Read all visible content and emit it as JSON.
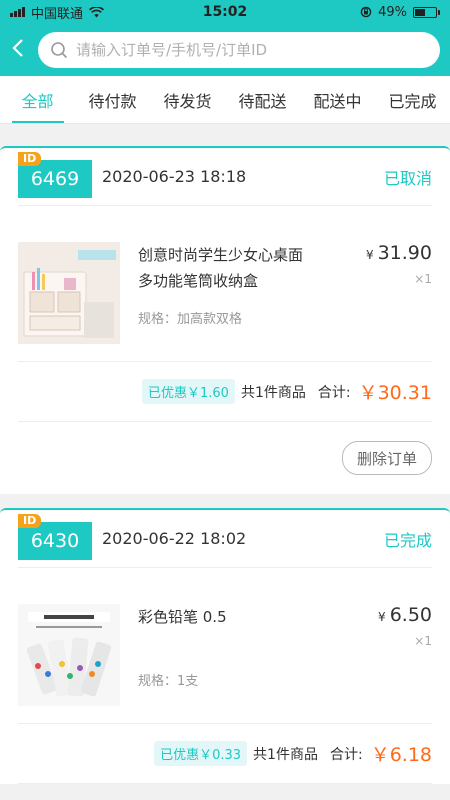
{
  "statusbar": {
    "carrier": "中国联通",
    "time": "15:02",
    "battery": "49%"
  },
  "search": {
    "placeholder": "请输入订单号/手机号/订单ID"
  },
  "tabs": [
    {
      "label": "全部",
      "active": true
    },
    {
      "label": "待付款"
    },
    {
      "label": "待发货"
    },
    {
      "label": "待配送"
    },
    {
      "label": "配送中"
    },
    {
      "label": "已完成"
    }
  ],
  "orders": [
    {
      "id_tag": "ID",
      "id": "6469",
      "date": "2020-06-23 18:18",
      "status": "已取消",
      "item": {
        "name_line1": "创意时尚学生少女心桌面",
        "name_line2": "多功能笔筒收纳盒",
        "spec": "规格：加高款双格",
        "currency": "¥",
        "price": "31.90",
        "qty": "×1"
      },
      "discount": "已优惠￥1.60",
      "count": "共1件商品",
      "total_label": "合计:",
      "total": "￥30.31",
      "action": "删除订单"
    },
    {
      "id_tag": "ID",
      "id": "6430",
      "date": "2020-06-22 18:02",
      "status": "已完成",
      "item": {
        "name_line1": "彩色铅笔 0.5",
        "name_line2": "",
        "spec": "规格：1支",
        "currency": "¥",
        "price": "6.50",
        "qty": "×1"
      },
      "discount": "已优惠￥0.33",
      "count": "共1件商品",
      "total_label": "合计:",
      "total": "￥6.18"
    }
  ],
  "colors": {
    "accent": "#1fc9c3",
    "price_total": "#ff6a1a",
    "id_tag": "#f7a21b"
  }
}
